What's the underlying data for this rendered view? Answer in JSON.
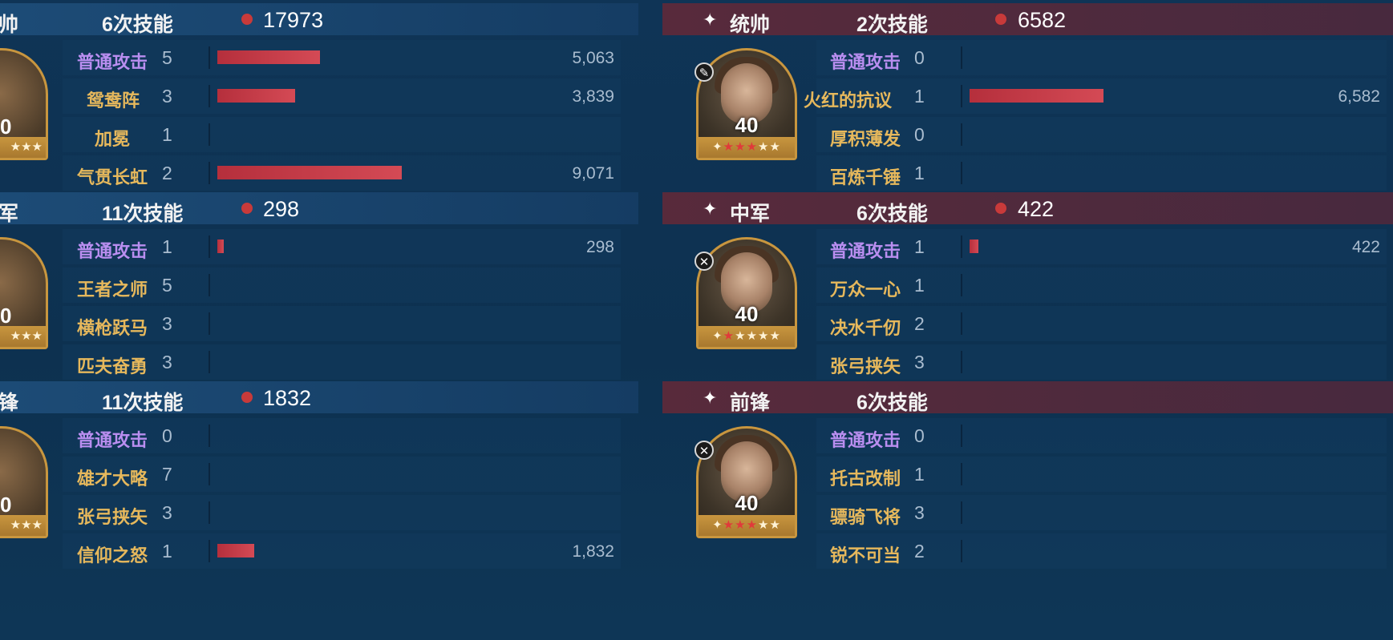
{
  "colors": {
    "background": "#0f3456",
    "header_blue": "#1e4e7a",
    "header_red": "#5c2a3a",
    "basic_attack": "#b98ef0",
    "skill_name": "#e6b85c",
    "damage_bar": "#c83a45",
    "frame_gold": "#c8963f"
  },
  "left": {
    "groups": [
      {
        "role": "帅",
        "count_label": "6次技能",
        "total": "17973",
        "level": "0",
        "rows": [
          {
            "name": "普通攻击",
            "type": "basic",
            "count": "5",
            "damage": "5,063",
            "value": 5063
          },
          {
            "name": "鸳鸯阵",
            "type": "skill",
            "count": "3",
            "damage": "3,839",
            "value": 3839
          },
          {
            "name": "加冕",
            "type": "skill",
            "count": "1",
            "damage": "",
            "value": 0
          },
          {
            "name": "气贯长虹",
            "type": "skill",
            "count": "2",
            "damage": "9,071",
            "value": 9071
          }
        ]
      },
      {
        "role": "军",
        "count_label": "11次技能",
        "total": "298",
        "level": "0",
        "rows": [
          {
            "name": "普通攻击",
            "type": "basic",
            "count": "1",
            "damage": "298",
            "value": 298
          },
          {
            "name": "王者之师",
            "type": "skill",
            "count": "5",
            "damage": "",
            "value": 0
          },
          {
            "name": "横枪跃马",
            "type": "skill",
            "count": "3",
            "damage": "",
            "value": 0
          },
          {
            "name": "匹夫奋勇",
            "type": "skill",
            "count": "3",
            "damage": "",
            "value": 0
          }
        ]
      },
      {
        "role": "锋",
        "count_label": "11次技能",
        "total": "1832",
        "level": "0",
        "rows": [
          {
            "name": "普通攻击",
            "type": "basic",
            "count": "0",
            "damage": "",
            "value": 0
          },
          {
            "name": "雄才大略",
            "type": "skill",
            "count": "7",
            "damage": "",
            "value": 0
          },
          {
            "name": "张弓挟矢",
            "type": "skill",
            "count": "3",
            "damage": "",
            "value": 0
          },
          {
            "name": "信仰之怒",
            "type": "skill",
            "count": "1",
            "damage": "1,832",
            "value": 1832
          }
        ]
      }
    ]
  },
  "right": {
    "groups": [
      {
        "role": "统帅",
        "star_glyph": "✦",
        "count_label": "2次技能",
        "total": "6582",
        "level": "40",
        "stars_lit": 3,
        "badge_icon": "sword-icon",
        "badge_glyph": "✎",
        "rows": [
          {
            "name": "普通攻击",
            "type": "basic",
            "count": "0",
            "damage": "",
            "value": 0
          },
          {
            "name": "火红的抗议",
            "type": "skill",
            "count": "1",
            "damage": "6,582",
            "value": 6582
          },
          {
            "name": "厚积薄发",
            "type": "skill",
            "count": "0",
            "damage": "",
            "value": 0
          },
          {
            "name": "百炼千锤",
            "type": "skill",
            "count": "1",
            "damage": "",
            "value": 0
          }
        ]
      },
      {
        "role": "中军",
        "star_glyph": "✦",
        "count_label": "6次技能",
        "total": "422",
        "level": "40",
        "stars_lit": 1,
        "badge_icon": "crossed-swords-icon",
        "badge_glyph": "✕",
        "rows": [
          {
            "name": "普通攻击",
            "type": "basic",
            "count": "1",
            "damage": "422",
            "value": 422
          },
          {
            "name": "万众一心",
            "type": "skill",
            "count": "1",
            "damage": "",
            "value": 0
          },
          {
            "name": "决水千仞",
            "type": "skill",
            "count": "2",
            "damage": "",
            "value": 0
          },
          {
            "name": "张弓挟矢",
            "type": "skill",
            "count": "3",
            "damage": "",
            "value": 0
          }
        ]
      },
      {
        "role": "前锋",
        "star_glyph": "✦",
        "count_label": "6次技能",
        "total": "",
        "level": "40",
        "stars_lit": 3,
        "badge_icon": "crossed-swords-icon",
        "badge_glyph": "✕",
        "rows": [
          {
            "name": "普通攻击",
            "type": "basic",
            "count": "0",
            "damage": "",
            "value": 0
          },
          {
            "name": "托古改制",
            "type": "skill",
            "count": "1",
            "damage": "",
            "value": 0
          },
          {
            "name": "骠骑飞将",
            "type": "skill",
            "count": "3",
            "damage": "",
            "value": 0
          },
          {
            "name": "锐不可当",
            "type": "skill",
            "count": "2",
            "damage": "",
            "value": 0
          }
        ]
      }
    ]
  }
}
